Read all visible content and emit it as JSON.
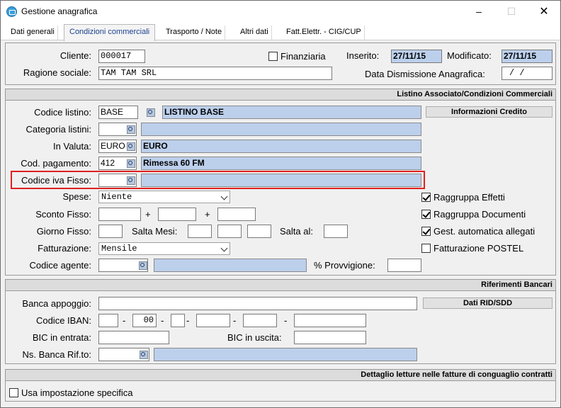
{
  "window": {
    "title": "Gestione anagrafica",
    "minimize_icon": "minimize-icon",
    "maximize_icon": "maximize-icon",
    "close_icon": "close-icon"
  },
  "tabs": [
    {
      "label": "Dati generali"
    },
    {
      "label": "Condizioni commerciali",
      "active": true
    },
    {
      "label": "Trasporto / Note"
    },
    {
      "label": "Altri dati"
    },
    {
      "label": "Fatt.Elettr. - CIG/CUP"
    }
  ],
  "header": {
    "cliente_label": "Cliente:",
    "cliente_value": "000017",
    "finanziaria_label": "Finanziaria",
    "finanziaria_checked": false,
    "inserito_label": "Inserito:",
    "inserito_value": "27/11/15",
    "modificato_label": "Modificato:",
    "modificato_value": "27/11/15",
    "ragione_label": "Ragione sociale:",
    "ragione_value": "TAM TAM SRL",
    "dismissione_label": "Data Dismissione Anagrafica:",
    "dismissione_value": "  /  /"
  },
  "listino": {
    "section_title": "Listino Associato/Condizioni Commerciali",
    "codice_listino_label": "Codice listino:",
    "codice_listino_value": "BASE",
    "codice_listino_desc": "LISTINO BASE",
    "info_credito_button": "Informazioni Credito",
    "categoria_label": "Categoria listini:",
    "categoria_value": "",
    "categoria_desc": "",
    "valuta_label": "In Valuta:",
    "valuta_value": "EURO",
    "valuta_desc": "EURO",
    "pagamento_label": "Cod. pagamento:",
    "pagamento_value": "412",
    "pagamento_desc": "Rimessa 60 FM",
    "iva_label": "Codice iva Fisso:",
    "iva_value": "",
    "iva_desc": "",
    "spese_label": "Spese:",
    "spese_value": "Niente",
    "sconto_label": "Sconto Fisso:",
    "plus": "+",
    "giorno_label": "Giorno Fisso:",
    "salta_mesi_label": "Salta Mesi:",
    "salta_al_label": "Salta al:",
    "fatturazione_label": "Fatturazione:",
    "fatturazione_value": "Mensile",
    "agente_label": "Codice agente:",
    "provvigione_label": "% Provvigione:",
    "check_raggruppa_effetti": "Raggruppa Effetti",
    "check_raggruppa_documenti": "Raggruppa Documenti",
    "check_gest_allegati": "Gest. automatica allegati",
    "check_postel": "Fatturazione POSTEL"
  },
  "banca": {
    "section_title": "Riferimenti Bancari",
    "banca_label": "Banca appoggio:",
    "dati_rid_button": "Dati RID/SDD",
    "iban_label": "Codice IBAN:",
    "iban_part2": "00",
    "dash": "-",
    "bic_entrata_label": "BIC in entrata:",
    "bic_uscita_label": "BIC in uscita:",
    "ns_banca_label": "Ns. Banca Rif.to:"
  },
  "conguaglio": {
    "section_title": "Dettaglio letture nelle fatture di conguaglio contratti",
    "usa_label": "Usa impostazione specifica"
  }
}
